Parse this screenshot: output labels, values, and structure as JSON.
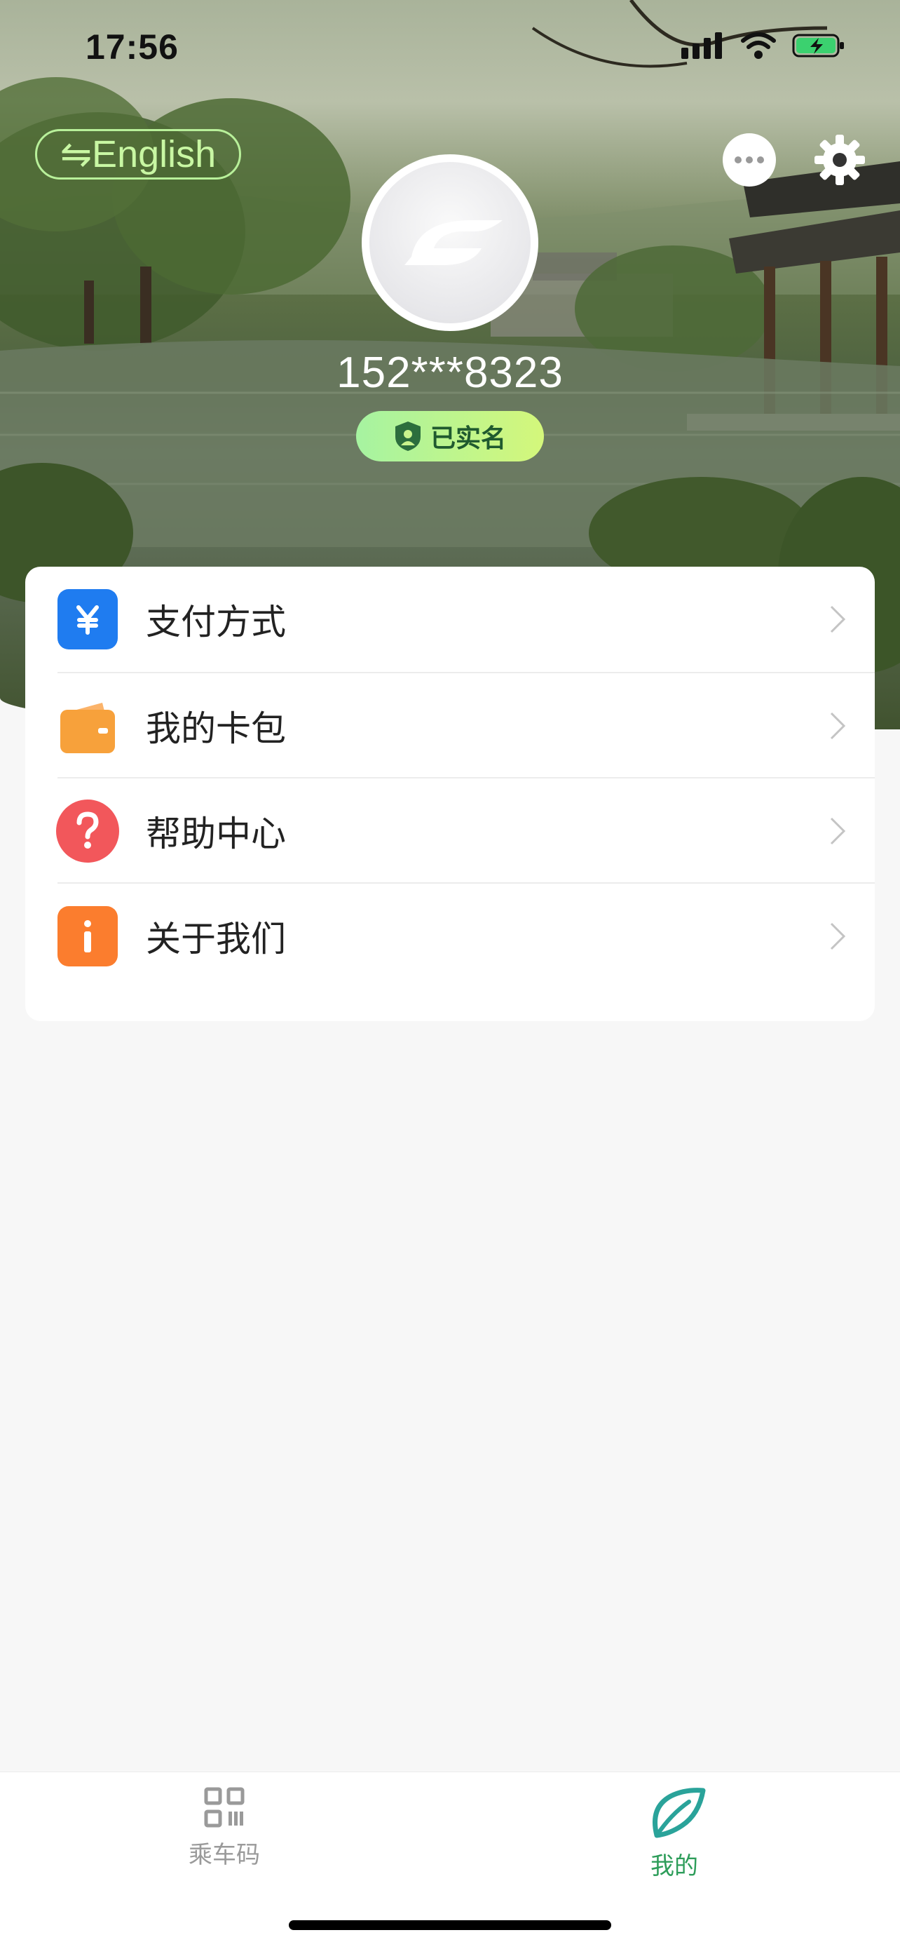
{
  "status_bar": {
    "time": "17:56"
  },
  "header": {
    "language_toggle": "⇋English",
    "user_phone": "152***8323",
    "verification_badge": "已实名"
  },
  "menu": [
    {
      "label": "支付方式",
      "icon": "yuan-icon",
      "color": "#1f7cf0"
    },
    {
      "label": "我的卡包",
      "icon": "wallet-icon",
      "color": "#f7a13b"
    },
    {
      "label": "帮助中心",
      "icon": "question-icon",
      "color": "#f2575b"
    },
    {
      "label": "关于我们",
      "icon": "info-icon",
      "color": "#fb7d2e"
    }
  ],
  "tabbar": {
    "tabs": [
      {
        "label": "乘车码",
        "icon": "qr-code-icon",
        "active": false
      },
      {
        "label": "我的",
        "icon": "leaf-icon",
        "active": true
      }
    ],
    "active_color": "#2e9d5a",
    "inactive_color": "#9a9a9a"
  }
}
